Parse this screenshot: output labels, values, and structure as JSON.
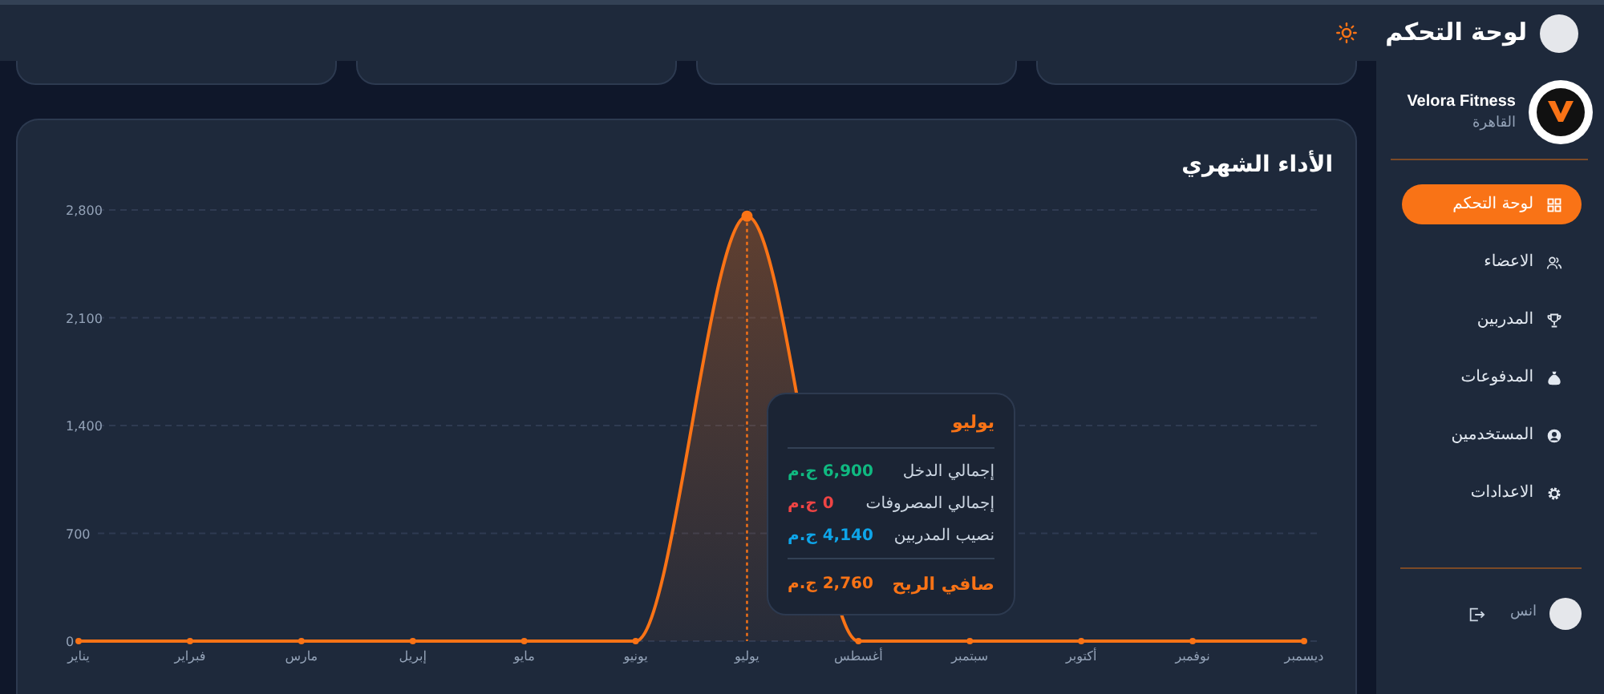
{
  "header": {
    "title": "لوحة التحكم"
  },
  "sidebar": {
    "brand": {
      "name": "Velora Fitness",
      "city": "القاهرة"
    },
    "items": [
      {
        "label": "لوحة التحكم",
        "selected": true
      },
      {
        "label": "الاعضاء",
        "selected": false
      },
      {
        "label": "المدربين",
        "selected": false
      },
      {
        "label": "المدفوعات",
        "selected": false
      },
      {
        "label": "المستخدمين",
        "selected": false
      },
      {
        "label": "الاعدادات",
        "selected": false
      }
    ],
    "user": {
      "name": "انس"
    }
  },
  "summary_cards": [
    {
      "kind": "card"
    },
    {
      "kind": "card"
    },
    {
      "kind": "card"
    },
    {
      "kind": "card"
    }
  ],
  "performance": {
    "title": "الأداء الشهري",
    "chart_data": {
      "type": "area",
      "categories": [
        "يناير",
        "فبراير",
        "مارس",
        "إبريل",
        "مايو",
        "يونيو",
        "يوليو",
        "أغسطس",
        "سبتمبر",
        "أكتوبر",
        "نوفمبر",
        "ديسمبر"
      ],
      "series": [
        {
          "color": "#f97316",
          "values": [
            0,
            0,
            0,
            0,
            0,
            0,
            2760,
            0,
            0,
            0,
            0,
            0
          ]
        }
      ],
      "grid": true,
      "ref_lines": [
        {
          "axis": "x",
          "value": "يوليو"
        }
      ],
      "ylim": [
        0,
        2800
      ],
      "yticks": [
        {
          "value": 0,
          "label": "0"
        },
        {
          "value": 700,
          "label": "700"
        },
        {
          "value": 1400,
          "label": "1,400"
        },
        {
          "value": 2100,
          "label": "2,100"
        },
        {
          "value": 2800,
          "label": "2,800"
        }
      ]
    },
    "tooltip": {
      "title": "يوليو",
      "rows": [
        {
          "label": "إجمالي الدخل",
          "value": "6,900 ج.م",
          "color": "#10b981"
        },
        {
          "label": "إجمالي المصروفات",
          "value": "0 ج.م",
          "color": "#ef4444"
        },
        {
          "label": "نصيب المدربين",
          "value": "4,140 ج.م",
          "color": "#0ea5e9"
        }
      ],
      "total": {
        "label": "صافي الربح",
        "value": "2,760 ج.م"
      }
    }
  }
}
